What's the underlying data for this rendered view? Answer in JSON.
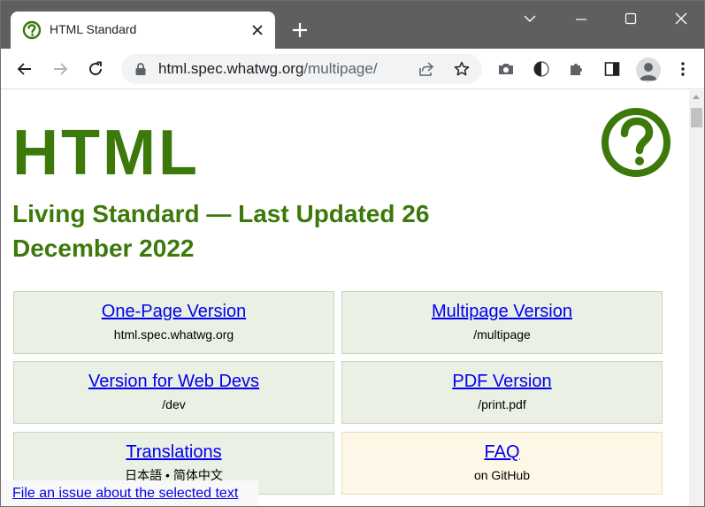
{
  "browser": {
    "tab": {
      "title": "HTML Standard"
    },
    "omnibox": {
      "host": "html.spec.whatwg.org",
      "path": "/multipage/"
    }
  },
  "page": {
    "heading": "HTML",
    "subheading": "Living Standard — Last Updated 26 December 2022",
    "cards": [
      {
        "link": "One-Page Version",
        "sub": "html.spec.whatwg.org"
      },
      {
        "link": "Multipage Version",
        "sub": "/multipage"
      },
      {
        "link": "Version for Web Devs",
        "sub": "/dev"
      },
      {
        "link": "PDF Version",
        "sub": "/print.pdf"
      },
      {
        "link": "Translations",
        "sub": "日本語 • 简体中文"
      },
      {
        "link": "FAQ",
        "sub": "on GitHub"
      }
    ],
    "issue_link": "File an issue about the selected text"
  },
  "colors": {
    "accent_green": "#3c790a",
    "link_blue": "#0000ee",
    "card_bg": "#eaf0e4",
    "faq_bg": "#fdf7e7"
  }
}
